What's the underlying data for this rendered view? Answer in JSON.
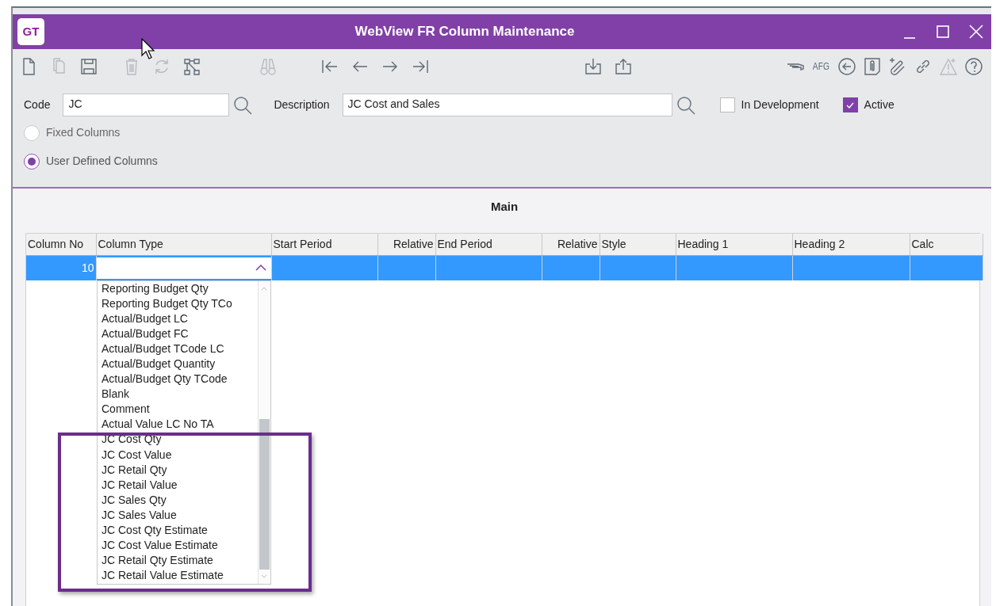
{
  "window": {
    "title": "WebView FR Column Maintenance",
    "logo": "GT"
  },
  "toolbar": {
    "groups": [
      [
        {
          "kind": "new",
          "disabled": false
        },
        {
          "kind": "copy",
          "disabled": true
        },
        {
          "kind": "save",
          "disabled": false
        }
      ],
      [
        {
          "kind": "delete",
          "disabled": true
        },
        {
          "kind": "refresh",
          "disabled": true
        },
        {
          "kind": "tree",
          "disabled": false
        }
      ],
      [
        {
          "kind": "find",
          "disabled": true
        }
      ],
      [
        {
          "kind": "first",
          "disabled": false
        },
        {
          "kind": "prev",
          "disabled": false
        },
        {
          "kind": "next",
          "disabled": false
        },
        {
          "kind": "last",
          "disabled": false
        }
      ],
      [
        {
          "kind": "import",
          "disabled": false
        },
        {
          "kind": "export",
          "disabled": false
        }
      ],
      [
        {
          "kind": "stapler",
          "disabled": false
        },
        {
          "kind": "text",
          "label": "AFG",
          "disabled": false
        },
        {
          "kind": "back",
          "disabled": false
        },
        {
          "kind": "document",
          "disabled": false
        },
        {
          "kind": "attach",
          "disabled": false
        },
        {
          "kind": "link",
          "disabled": false
        },
        {
          "kind": "warning",
          "disabled": true
        },
        {
          "kind": "help",
          "disabled": false
        }
      ]
    ]
  },
  "form": {
    "code": {
      "label": "Code",
      "value": "JC"
    },
    "description": {
      "label": "Description",
      "value": "JC Cost and Sales"
    },
    "checkboxes": [
      {
        "label": "In Development",
        "checked": false
      },
      {
        "label": "Active",
        "checked": true
      }
    ],
    "column_mode": [
      {
        "label": "Fixed Columns",
        "selected": false,
        "disabled": true
      },
      {
        "label": "User Defined Columns",
        "selected": true,
        "disabled": false
      }
    ]
  },
  "tab": {
    "label": "Main"
  },
  "table": {
    "columns": [
      {
        "label": "Column No"
      },
      {
        "label": "Column Type"
      },
      {
        "label": "Start Period"
      },
      {
        "label": "Relative"
      },
      {
        "label": "End Period"
      },
      {
        "label": "Relative"
      },
      {
        "label": "Style"
      },
      {
        "label": "Heading 1"
      },
      {
        "label": "Heading 2"
      },
      {
        "label": "Calc"
      }
    ],
    "rows": [
      {
        "column_no": "10",
        "selected": true
      }
    ]
  },
  "dropdown": {
    "expanded": true,
    "items": [
      "Reporting Budget Qty",
      "Reporting Budget Qty TCo",
      "Actual/Budget LC",
      "Actual/Budget FC",
      "Actual/Budget TCode LC",
      "Actual/Budget Quantity",
      "Actual/Budget Qty TCode",
      "Blank",
      "Comment",
      "Actual Value LC No TA",
      "JC Cost Qty",
      "JC Cost Value",
      "JC Retail Qty",
      "JC Retail Value",
      "JC Sales Qty",
      "JC Sales Value",
      "JC Cost Qty Estimate",
      "JC Cost Value Estimate",
      "JC Retail Qty Estimate",
      "JC Retail Value Estimate"
    ]
  }
}
